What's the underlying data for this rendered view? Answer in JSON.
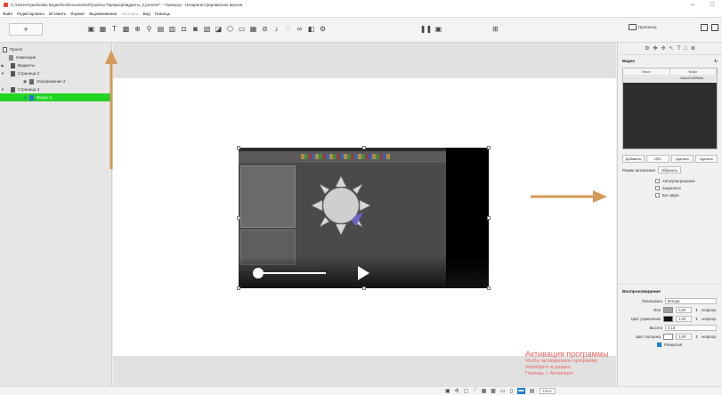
{
  "window": {
    "title": "C:/Users/Vyacheslav Bogachev/Documents/Проекты Премьер/видаеты_2.premier* – Премьер - Незарегистрированная версия",
    "minimize": "–",
    "maximize": "□"
  },
  "menu": [
    "Файл",
    "Редактировать",
    "Вставить",
    "Формат",
    "Выравнивание",
    "Экспорта",
    "Вид",
    "Помощь"
  ],
  "menu_disabled": "Экспорта",
  "toolbar": {
    "add_label": "+",
    "preview_label": "Просмотр"
  },
  "tree": {
    "project": "Проект",
    "navigation": "Навигация",
    "widgets": "Виджеты",
    "page2": "Страница 2",
    "image2": "Изображение 2",
    "page3": "Страница 3",
    "video3": "Видео 3"
  },
  "activation": {
    "title": "Активация программы",
    "line1": "Чтобы активировать программу",
    "line2": "перейдите в раздел",
    "line3": "Помощь > Активация"
  },
  "right_panel": {
    "section_title": "Видео",
    "table_headers": [
      "Текст",
      "Файл"
    ],
    "table_row_file": "3d4cd7d59f2ab...",
    "buttons": [
      "Добавить",
      "URL",
      "Удалить",
      "Удалить"
    ],
    "fill_mode_label": "Режим заполнения",
    "fill_mode_value": "Обрезать",
    "checks": [
      "Автопроигрывание",
      "Зациклено",
      "Без звука"
    ],
    "playback_title": "Воспроизведение",
    "show_label": "Показывать",
    "show_value": "Всегда",
    "bg_label": "Фон",
    "bg_value": "0,20",
    "opacity_label": "непрозр.",
    "controls_color_label": "Цвет управления",
    "controls_value": "1,00",
    "height_label": "Высота",
    "height_value": "0,10",
    "bar_color_label": "Цвет ползунка",
    "bar_value": "1,00",
    "blur_label": "Размытый"
  },
  "status": {
    "zoom": "100%"
  },
  "colors": {
    "selection": "#23d323",
    "accent": "#1a7fd6",
    "arrow": "#d39a5a",
    "activation": "#e8685f"
  }
}
